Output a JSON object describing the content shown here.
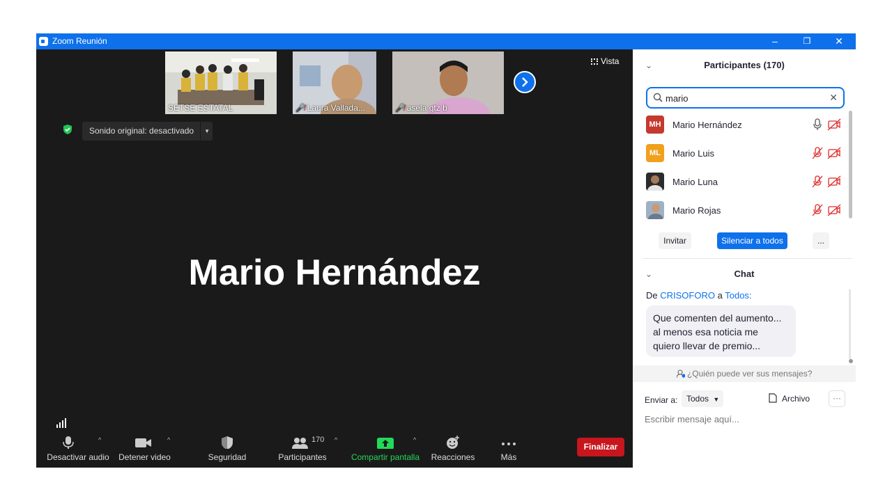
{
  "window": {
    "title": "Zoom Reunión",
    "minimize": "–",
    "restore": "❐",
    "close": "✕"
  },
  "thumbnails": [
    {
      "name": "SETSE ESTATAL",
      "muted": false
    },
    {
      "name": "Laura Vallada...",
      "muted": true
    },
    {
      "name": "asela gtz b",
      "muted": true
    }
  ],
  "view_button": "Vista",
  "sound_pill": "Sonido original: desactivado",
  "active_speaker": "Mario Hernández",
  "toolbar": {
    "audio": "Desactivar audio",
    "video": "Detener video",
    "security": "Seguridad",
    "participants": "Participantes",
    "participants_count": "170",
    "share": "Compartir pantalla",
    "reactions": "Reacciones",
    "more": "Más",
    "end": "Finalizar"
  },
  "colors": {
    "accent": "#0e71eb",
    "share_green": "#23d959",
    "end_red": "#c7161d"
  },
  "participants_panel": {
    "title": "Participantes (170)",
    "search_value": "mario",
    "items": [
      {
        "initials": "MH",
        "name": "Mario Hernández",
        "avatar_color": "#c5392e",
        "mic": "on",
        "cam": "off"
      },
      {
        "initials": "ML",
        "name": "Mario Luis",
        "avatar_color": "#f0a01c",
        "mic": "off",
        "cam": "off"
      },
      {
        "initials": "",
        "name": "Mario Luna",
        "avatar_color": "#3a3a3a",
        "mic": "off",
        "cam": "off"
      },
      {
        "initials": "",
        "name": "Mario Rojas",
        "avatar_color": "#8fa2b5",
        "mic": "off",
        "cam": "off"
      }
    ],
    "invite": "Invitar",
    "mute_all": "Silenciar a todos",
    "more": "..."
  },
  "chat": {
    "title": "Chat",
    "from_prefix": "De",
    "from": "CRISOFORO",
    "to_prefix": "a",
    "to": "Todos:",
    "message_lines": [
      "Que comenten del aumento...",
      "al menos esa noticia me",
      "quiero llevar de premio..."
    ],
    "who_can_see": "¿Quién puede ver sus mensajes?",
    "send_to_label": "Enviar a:",
    "send_to_value": "Todos",
    "file_button": "Archivo",
    "more": "···",
    "input_placeholder": "Escribir mensaje aquí..."
  }
}
